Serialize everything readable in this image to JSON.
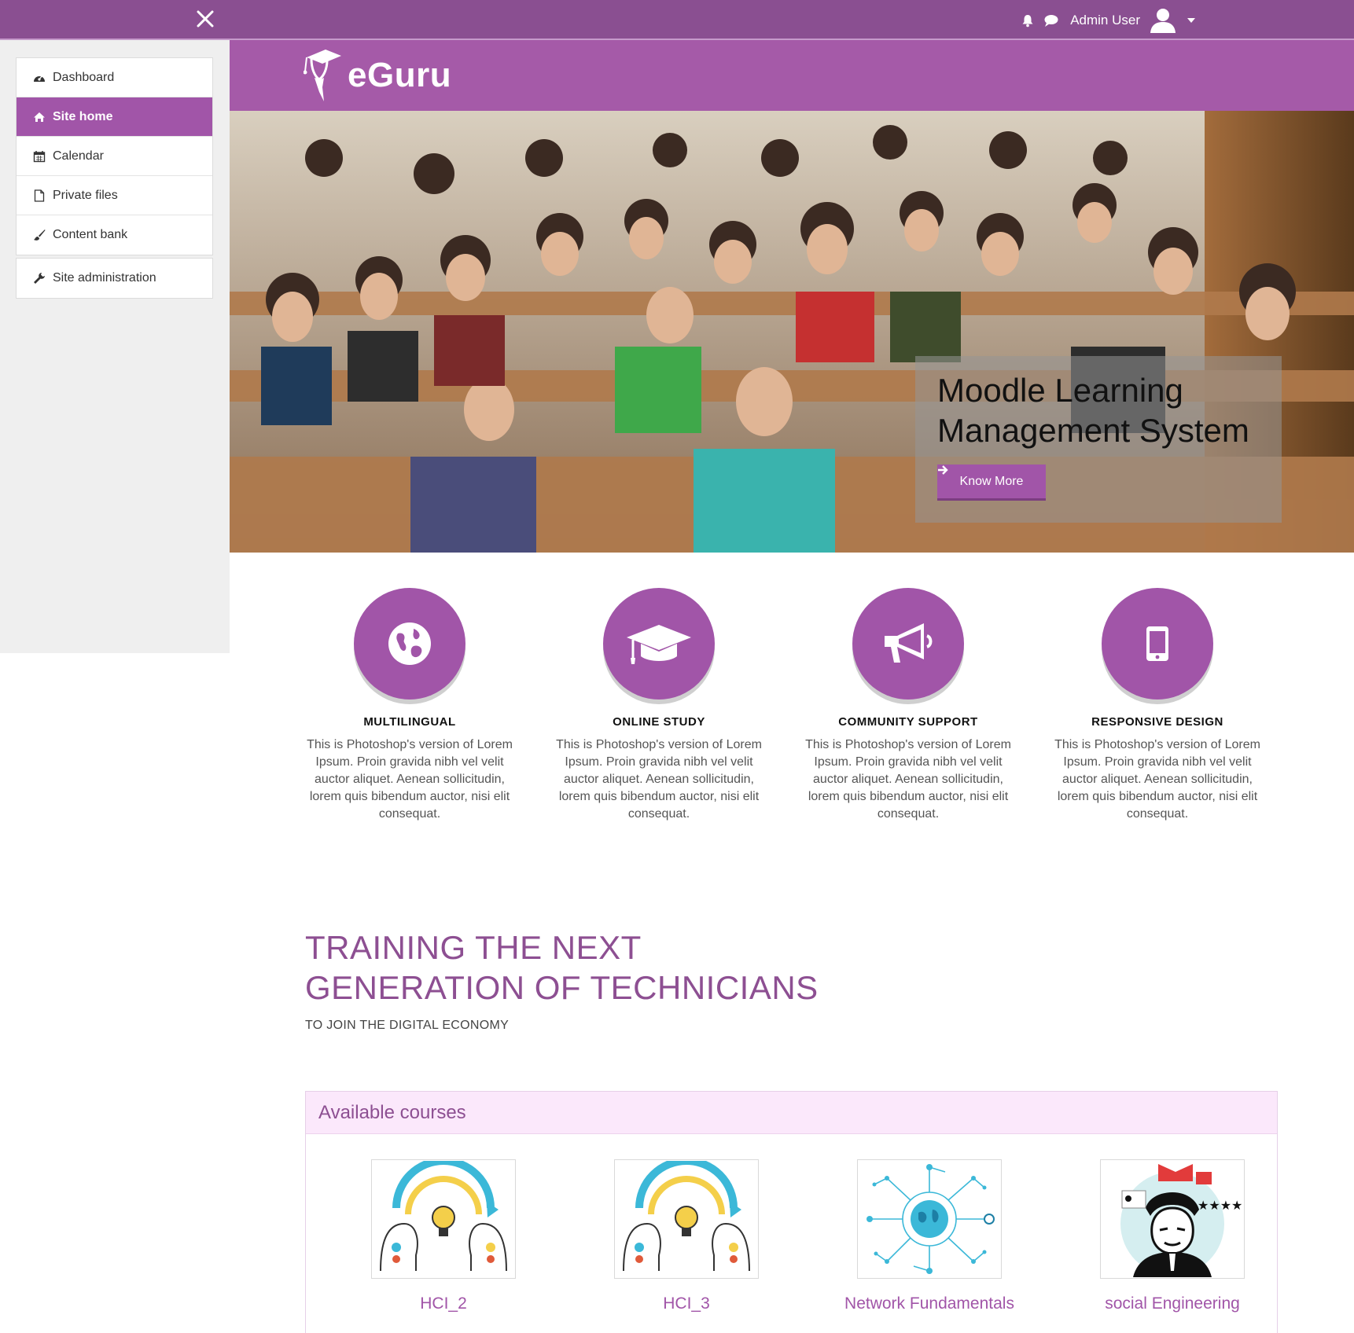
{
  "topbar": {
    "close_icon": "close-icon",
    "user_name": "Admin User",
    "icons": [
      "bell-icon",
      "chat-icon",
      "avatar-icon",
      "caret-down-icon"
    ]
  },
  "sidebar": {
    "items": [
      {
        "label": "Dashboard",
        "icon": "dashboard-icon"
      },
      {
        "label": "Site home",
        "icon": "home-icon",
        "active": true
      },
      {
        "label": "Calendar",
        "icon": "calendar-icon"
      },
      {
        "label": "Private files",
        "icon": "file-icon"
      },
      {
        "label": "Content bank",
        "icon": "brush-icon"
      }
    ],
    "admin_item": {
      "label": "Site administration",
      "icon": "wrench-icon"
    }
  },
  "brand": {
    "name": "eGuru"
  },
  "hero": {
    "title_line1": "Moodle Learning",
    "title_line2": "Management System",
    "button_label": "Know More"
  },
  "features": [
    {
      "title": "MULTILINGUAL",
      "icon": "globe-icon",
      "text": "This is Photoshop's version of Lorem Ipsum. Proin gravida nibh vel velit auctor aliquet. Aenean sollicitudin, lorem quis bibendum auctor, nisi elit consequat."
    },
    {
      "title": "ONLINE STUDY",
      "icon": "graduation-cap-icon",
      "text": "This is Photoshop's version of Lorem Ipsum. Proin gravida nibh vel velit auctor aliquet. Aenean sollicitudin, lorem quis bibendum auctor, nisi elit consequat."
    },
    {
      "title": "COMMUNITY SUPPORT",
      "icon": "megaphone-icon",
      "text": "This is Photoshop's version of Lorem Ipsum. Proin gravida nibh vel velit auctor aliquet. Aenean sollicitudin, lorem quis bibendum auctor, nisi elit consequat."
    },
    {
      "title": "RESPONSIVE DESIGN",
      "icon": "mobile-icon",
      "text": "This is Photoshop's version of Lorem Ipsum. Proin gravida nibh vel velit auctor aliquet. Aenean sollicitudin, lorem quis bibendum auctor, nisi elit consequat."
    }
  ],
  "training": {
    "heading_line1": "TRAINING THE NEXT",
    "heading_line2": "GENERATION OF TECHNICIANS",
    "subtitle": "TO JOIN THE DIGITAL ECONOMY"
  },
  "courses": {
    "heading": "Available courses",
    "items": [
      {
        "name": "HCI_2"
      },
      {
        "name": "HCI_3"
      },
      {
        "name": "Network Fundamentals"
      },
      {
        "name": "social Engineering"
      }
    ]
  },
  "colors": {
    "topbar": "#8a4f91",
    "brand": "#a55aa8",
    "accent": "#a155a8",
    "heading": "#8d4f92",
    "courses_header_bg": "#fbe8fb"
  }
}
